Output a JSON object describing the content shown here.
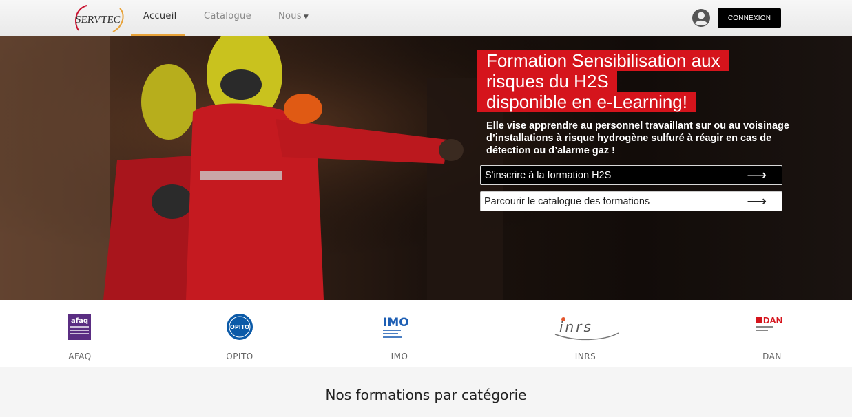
{
  "header": {
    "logo_text": "SERVTEC",
    "nav": [
      {
        "label": "Accueil"
      },
      {
        "label": "Catalogue"
      },
      {
        "label": "Nous"
      }
    ],
    "login_label": "CONNEXION",
    "icons": {
      "user": "user-circle-icon",
      "caret": "chevron-down-icon"
    }
  },
  "hero": {
    "headline_lines": [
      "Formation Sensibilisation aux",
      "risques du H2S",
      "disponible en e-Learning!"
    ],
    "description": "Elle vise apprendre au personnel travaillant sur ou au voisinage d’installations à risque hydrogène sulfuré à réagir en cas de détection ou d’alarme gaz !",
    "cta_primary": "S'inscrire à la formation H2S",
    "cta_secondary": "Parcourir le catalogue des formations",
    "arrow": "⟶"
  },
  "partners": [
    {
      "name": "AFAQ",
      "logo_text": "afaq"
    },
    {
      "name": "OPITO",
      "logo_text": "OPITO"
    },
    {
      "name": "IMO",
      "logo_text": "IMO"
    },
    {
      "name": "INRS",
      "logo_text": "inrs"
    },
    {
      "name": "DAN",
      "logo_text": "DAN"
    }
  ],
  "section_title": "Nos formations par catégorie",
  "colors": {
    "accent": "#d5141c",
    "nav_underline": "#e8a33a",
    "button_dark": "#000000"
  }
}
